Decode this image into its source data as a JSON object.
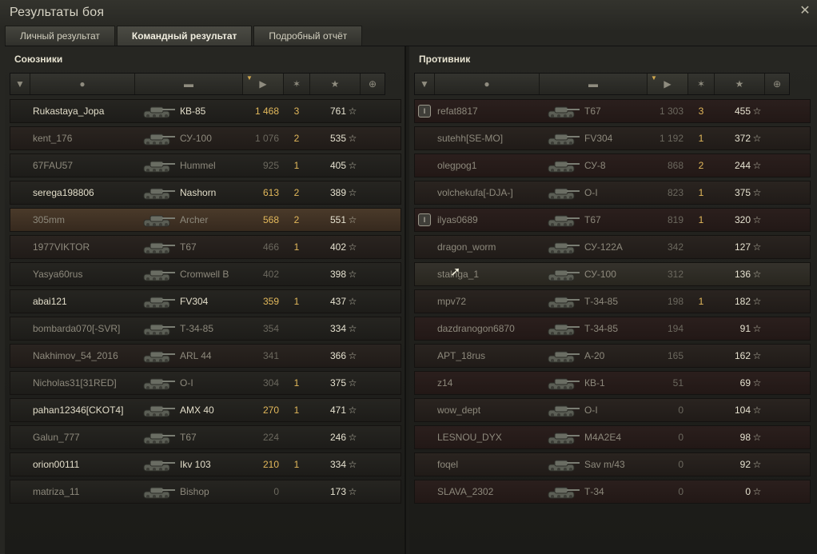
{
  "window": {
    "title": "Результаты боя",
    "close_icon": "close-icon"
  },
  "tabs": [
    {
      "label": "Личный результат",
      "active": false
    },
    {
      "label": "Командный результат",
      "active": true
    },
    {
      "label": "Подробный отчёт",
      "active": false
    }
  ],
  "allies": {
    "title": "Союзники",
    "rows": [
      {
        "name": "Rukastaya_Jopa",
        "tank": "КВ-85",
        "damage": "1 468",
        "frags": "3",
        "xp": "761",
        "alive": true
      },
      {
        "name": "kent_176",
        "tank": "СУ-100",
        "damage": "1 076",
        "frags": "2",
        "xp": "535",
        "alive": false
      },
      {
        "name": "67FAU57",
        "tank": "Hummel",
        "damage": "925",
        "frags": "1",
        "xp": "405",
        "alive": false
      },
      {
        "name": "serega198806",
        "tank": "Nashorn",
        "damage": "613",
        "frags": "2",
        "xp": "389",
        "alive": true
      },
      {
        "name": "305mm",
        "tank": "Archer",
        "damage": "568",
        "frags": "2",
        "xp": "551",
        "alive": false,
        "me": true
      },
      {
        "name": "1977VIKTOR",
        "tank": "T67",
        "damage": "466",
        "frags": "1",
        "xp": "402",
        "alive": false
      },
      {
        "name": "Yasya60rus",
        "tank": "Cromwell B",
        "damage": "402",
        "frags": "",
        "xp": "398",
        "alive": false
      },
      {
        "name": "abai121",
        "tank": "FV304",
        "damage": "359",
        "frags": "1",
        "xp": "437",
        "alive": true
      },
      {
        "name": "bombarda070[-SVR]",
        "tank": "Т-34-85",
        "damage": "354",
        "frags": "",
        "xp": "334",
        "alive": false
      },
      {
        "name": "Nakhimov_54_2016",
        "tank": "ARL 44",
        "damage": "341",
        "frags": "",
        "xp": "366",
        "alive": false
      },
      {
        "name": "Nicholas31[31RED]",
        "tank": "O-I",
        "damage": "304",
        "frags": "1",
        "xp": "375",
        "alive": false
      },
      {
        "name": "pahan12346[CKOT4]",
        "tank": "AMX 40",
        "damage": "270",
        "frags": "1",
        "xp": "471",
        "alive": true
      },
      {
        "name": "Galun_777",
        "tank": "T67",
        "damage": "224",
        "frags": "",
        "xp": "246",
        "alive": false
      },
      {
        "name": "orion00111",
        "tank": "Ikv 103",
        "damage": "210",
        "frags": "1",
        "xp": "334",
        "alive": true
      },
      {
        "name": "matriza_11",
        "tank": "Bishop",
        "damage": "0",
        "frags": "",
        "xp": "173",
        "alive": false
      }
    ]
  },
  "enemies": {
    "title": "Противник",
    "rows": [
      {
        "name": "refat8817",
        "tank": "T67",
        "damage": "1 303",
        "frags": "3",
        "xp": "455",
        "alive": false,
        "platoon": true
      },
      {
        "name": "sutehh[SE-MO]",
        "tank": "FV304",
        "damage": "1 192",
        "frags": "1",
        "xp": "372",
        "alive": false
      },
      {
        "name": "olegpog1",
        "tank": "СУ-8",
        "damage": "868",
        "frags": "2",
        "xp": "244",
        "alive": false
      },
      {
        "name": "volchekufa[-DJA-]",
        "tank": "O-I",
        "damage": "823",
        "frags": "1",
        "xp": "375",
        "alive": false
      },
      {
        "name": "ilyas0689",
        "tank": "T67",
        "damage": "819",
        "frags": "1",
        "xp": "320",
        "alive": false,
        "platoon": true
      },
      {
        "name": "dragon_worm",
        "tank": "СУ-122А",
        "damage": "342",
        "frags": "",
        "xp": "127",
        "alive": false
      },
      {
        "name": "stalnga_1",
        "tank": "СУ-100",
        "damage": "312",
        "frags": "",
        "xp": "136",
        "alive": false,
        "hover": true
      },
      {
        "name": "mpv72",
        "tank": "Т-34-85",
        "damage": "198",
        "frags": "1",
        "xp": "182",
        "alive": false
      },
      {
        "name": "dazdranogon6870",
        "tank": "Т-34-85",
        "damage": "194",
        "frags": "",
        "xp": "91",
        "alive": false
      },
      {
        "name": "APT_18rus",
        "tank": "А-20",
        "damage": "165",
        "frags": "",
        "xp": "162",
        "alive": false
      },
      {
        "name": "z14",
        "tank": "КВ-1",
        "damage": "51",
        "frags": "",
        "xp": "69",
        "alive": false
      },
      {
        "name": "wow_dept",
        "tank": "O-I",
        "damage": "0",
        "frags": "",
        "xp": "104",
        "alive": false
      },
      {
        "name": "LESNOU_DYX",
        "tank": "M4A2E4",
        "damage": "0",
        "frags": "",
        "xp": "98",
        "alive": false
      },
      {
        "name": "foqel",
        "tank": "Sav m/43",
        "damage": "0",
        "frags": "",
        "xp": "92",
        "alive": false
      },
      {
        "name": "SLAVA_2302",
        "tank": "Т-34",
        "damage": "0",
        "frags": "",
        "xp": "0",
        "alive": false
      }
    ]
  },
  "header_icons": [
    "platoon-icon",
    "player-icon",
    "tank-icon",
    "damage-icon",
    "frags-icon",
    "xp-star-icon",
    "medal-icon"
  ],
  "colors": {
    "gold": "#e2b85b",
    "text": "#e2ddc9",
    "dim": "#8d897c"
  }
}
